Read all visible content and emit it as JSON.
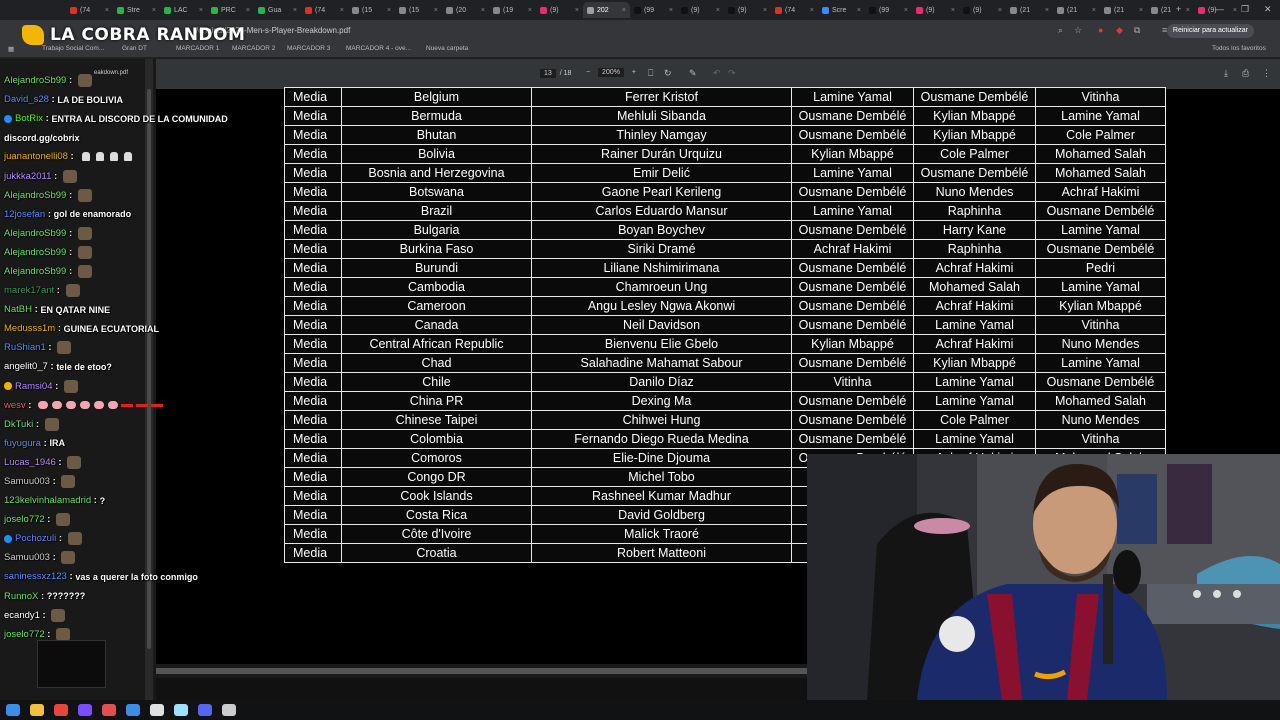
{
  "browser": {
    "tabs": [
      {
        "label": "(74",
        "color": "#e52d27"
      },
      {
        "label": "Stre",
        "color": "#2bb24c"
      },
      {
        "label": "LAC",
        "color": "#2bb24c"
      },
      {
        "label": "PRC",
        "color": "#2bb24c"
      },
      {
        "label": "Gua",
        "color": "#2bb24c"
      },
      {
        "label": "(74",
        "color": "#e52d27"
      },
      {
        "label": "(15",
        "color": "#888888"
      },
      {
        "label": "(15",
        "color": "#888888"
      },
      {
        "label": "(20",
        "color": "#888888"
      },
      {
        "label": "(19",
        "color": "#888888"
      },
      {
        "label": "(9)",
        "color": "#e1306c"
      },
      {
        "label": "202",
        "color": "#9aa0a6",
        "active": true
      },
      {
        "label": "(99",
        "color": "#111111"
      },
      {
        "label": "(9)",
        "color": "#111111"
      },
      {
        "label": "(9)",
        "color": "#111111"
      },
      {
        "label": "(74",
        "color": "#e52d27"
      },
      {
        "label": "Scre",
        "color": "#4285f4"
      },
      {
        "label": "(99",
        "color": "#111111"
      },
      {
        "label": "(9)",
        "color": "#e1306c"
      },
      {
        "label": "(9)",
        "color": "#111111"
      },
      {
        "label": "(21",
        "color": "#888888"
      },
      {
        "label": "(21",
        "color": "#888888"
      },
      {
        "label": "(21",
        "color": "#888888"
      },
      {
        "label": "(21",
        "color": "#888888"
      },
      {
        "label": "(9)",
        "color": "#e1306c"
      }
    ],
    "url": "/original/2025-Men-s-Player-Breakdown.pdf",
    "update_button": "Reiniciar para actualizar",
    "bookmarks": [
      "Trabajo Social Com...",
      "Gran DT",
      "MARCADOR 1",
      "MARCADOR 2",
      "MARCADOR 3",
      "MARCADOR 4 - ove...",
      "Nueva carpeta"
    ],
    "all_bookmarks": "Todos los favoritos"
  },
  "logo": {
    "text": "LA COBRA RANDOM"
  },
  "pdf": {
    "page_current": "13",
    "page_total": "/ 18",
    "zoom": "200%",
    "rows": [
      [
        "Media",
        "Belgium",
        "Ferrer Kristof",
        "Lamine Yamal",
        "Ousmane Dembélé",
        "Vitinha"
      ],
      [
        "Media",
        "Bermuda",
        "Mehluli Sibanda",
        "Ousmane Dembélé",
        "Kylian Mbappé",
        "Lamine Yamal"
      ],
      [
        "Media",
        "Bhutan",
        "Thinley Namgay",
        "Ousmane Dembélé",
        "Kylian Mbappé",
        "Cole Palmer"
      ],
      [
        "Media",
        "Bolivia",
        "Rainer Durán Urquizu",
        "Kylian Mbappé",
        "Cole Palmer",
        "Mohamed Salah"
      ],
      [
        "Media",
        "Bosnia and Herzegovina",
        "Emir Delić",
        "Lamine Yamal",
        "Ousmane Dembélé",
        "Mohamed Salah"
      ],
      [
        "Media",
        "Botswana",
        "Gaone Pearl Kerileng",
        "Ousmane Dembélé",
        "Nuno Mendes",
        "Achraf Hakimi"
      ],
      [
        "Media",
        "Brazil",
        "Carlos Eduardo Mansur",
        "Lamine Yamal",
        "Raphinha",
        "Ousmane Dembélé"
      ],
      [
        "Media",
        "Bulgaria",
        "Boyan Boychev",
        "Ousmane Dembélé",
        "Harry Kane",
        "Lamine Yamal"
      ],
      [
        "Media",
        "Burkina Faso",
        "Siriki Dramé",
        "Achraf Hakimi",
        "Raphinha",
        "Ousmane Dembélé"
      ],
      [
        "Media",
        "Burundi",
        "Liliane Nshimirimana",
        "Ousmane Dembélé",
        "Achraf Hakimi",
        "Pedri"
      ],
      [
        "Media",
        "Cambodia",
        "Chamroeun Ung",
        "Ousmane Dembélé",
        "Mohamed Salah",
        "Lamine Yamal"
      ],
      [
        "Media",
        "Cameroon",
        "Angu Lesley Ngwa Akonwi",
        "Ousmane Dembélé",
        "Achraf Hakimi",
        "Kylian Mbappé"
      ],
      [
        "Media",
        "Canada",
        "Neil Davidson",
        "Ousmane Dembélé",
        "Lamine Yamal",
        "Vitinha"
      ],
      [
        "Media",
        "Central African Republic",
        "Bienvenu Elie Gbelo",
        "Kylian Mbappé",
        "Achraf Hakimi",
        "Nuno Mendes"
      ],
      [
        "Media",
        "Chad",
        "Salahadine Mahamat Sabour",
        "Ousmane Dembélé",
        "Kylian Mbappé",
        "Lamine Yamal"
      ],
      [
        "Media",
        "Chile",
        "Danilo Díaz",
        "Vitinha",
        "Lamine Yamal",
        "Ousmane Dembélé"
      ],
      [
        "Media",
        "China PR",
        "Dexing Ma",
        "Ousmane Dembélé",
        "Lamine Yamal",
        "Mohamed Salah"
      ],
      [
        "Media",
        "Chinese Taipei",
        "Chihwei Hung",
        "Ousmane Dembélé",
        "Cole Palmer",
        "Nuno Mendes"
      ],
      [
        "Media",
        "Colombia",
        "Fernando Diego Rueda Medina",
        "Ousmane Dembélé",
        "Lamine Yamal",
        "Vitinha"
      ],
      [
        "Media",
        "Comoros",
        "Elie-Dine Djouma",
        "Ousmane Dembélé",
        "Achraf Hakimi",
        "Mohamed Salah"
      ],
      [
        "Media",
        "Congo DR",
        "Michel Tobo",
        "",
        "",
        ""
      ],
      [
        "Media",
        "Cook Islands",
        "Rashneel Kumar Madhur",
        "Ou",
        "",
        ""
      ],
      [
        "Media",
        "Costa Rica",
        "David Goldberg",
        "Ou",
        "",
        ""
      ],
      [
        "Media",
        "Côte d'Ivoire",
        "Malick Traoré",
        "Ou",
        "",
        ""
      ],
      [
        "Media",
        "Croatia",
        "Robert Matteoni",
        "Ou",
        "",
        ""
      ]
    ]
  },
  "chat": {
    "file_label": "eakdown.pdf",
    "messages": [
      {
        "user": "AlejandroSb99",
        "color": "#6be36b",
        "text": "",
        "emote": true
      },
      {
        "user": "David_s28",
        "color": "#5b8cff",
        "text": "LA DE BOLIVIA"
      },
      {
        "user": "BotRix",
        "color": "#53fc18",
        "text": "ENTRA AL DISCORD DE LA COMUNIDAD",
        "badge": "#1e8fff"
      },
      {
        "user": "",
        "color": "#ffffff",
        "text": "discord.gg/cobrix"
      },
      {
        "user": "juanantonelli08",
        "color": "#f0b400",
        "text": "",
        "tiny": 4
      },
      {
        "user": "jukkka2011",
        "color": "#b889ff",
        "text": "",
        "emote": true
      },
      {
        "user": "AlejandroSb99",
        "color": "#6be36b",
        "text": "",
        "emote": true
      },
      {
        "user": "12josefan",
        "color": "#5b8cff",
        "text": "gol de enamorado"
      },
      {
        "user": "AlejandroSb99",
        "color": "#6be36b",
        "text": "",
        "emote": true
      },
      {
        "user": "AlejandroSb99",
        "color": "#6be36b",
        "text": "",
        "emote": true
      },
      {
        "user": "AlejandroSb99",
        "color": "#6be36b",
        "text": "",
        "emote": true
      },
      {
        "user": "marek17ant",
        "color": "#3a9a55",
        "text": "",
        "emote": true
      },
      {
        "user": "NatBH",
        "color": "#6be36b",
        "text": "EN QATAR NINE"
      },
      {
        "user": "Medusss1m",
        "color": "#f0b400",
        "text": "GUINEA ECUATORIAL"
      },
      {
        "user": "RuShian1",
        "color": "#5b8cff",
        "text": "",
        "emote": true
      },
      {
        "user": "angelit0_7",
        "color": "#ffffff",
        "text": "tele de etoo?"
      },
      {
        "user": "Ramsi04",
        "color": "#b889ff",
        "text": "",
        "emote": true,
        "badge": "#f0b400"
      },
      {
        "user": "wesv",
        "color": "#ff4d6d",
        "text": "",
        "pills": 6
      },
      {
        "user": "DkTuki",
        "color": "#6be36b",
        "text": "",
        "emote": true
      },
      {
        "user": "fuyugura",
        "color": "#5b8cff",
        "text": "IRA"
      },
      {
        "user": "Lucas_1946",
        "color": "#b889ff",
        "text": "",
        "emote": true
      },
      {
        "user": "Samuu003",
        "color": "#cccccc",
        "text": "",
        "emote": true
      },
      {
        "user": "123kelvinhalamadrid",
        "color": "#6be36b",
        "text": "?"
      },
      {
        "user": "joselo772",
        "color": "#6be36b",
        "text": "",
        "emote": true
      },
      {
        "user": "Pochozuli",
        "color": "#5b8cff",
        "text": "",
        "emote": true,
        "badge": "#1e8fff"
      },
      {
        "user": "Samuu003",
        "color": "#cccccc",
        "text": "",
        "emote": true
      },
      {
        "user": "saninessxz123",
        "color": "#5b8cff",
        "text": "vas a querer la foto conmigo"
      },
      {
        "user": "RunnoX",
        "color": "#6be36b",
        "text": "???????"
      },
      {
        "user": "ecandy1",
        "color": "#ffffff",
        "text": "",
        "emote": true
      },
      {
        "user": "joselo772",
        "color": "#6be36b",
        "text": "",
        "emote": true
      }
    ]
  },
  "taskbar": {
    "icons": [
      {
        "name": "windows-icon",
        "color": "#3a8ee6"
      },
      {
        "name": "files-icon",
        "color": "#f0c040"
      },
      {
        "name": "chrome-icon",
        "color": "#e8453c"
      },
      {
        "name": "app-icon",
        "color": "#7b4dff"
      },
      {
        "name": "app-icon",
        "color": "#e05050"
      },
      {
        "name": "app-icon",
        "color": "#3a8ee6"
      },
      {
        "name": "app-icon",
        "color": "#e0e0e0"
      },
      {
        "name": "app-icon",
        "color": "#9be2ff"
      },
      {
        "name": "app-icon",
        "color": "#5865f2"
      },
      {
        "name": "app-icon",
        "color": "#cccccc"
      }
    ]
  }
}
